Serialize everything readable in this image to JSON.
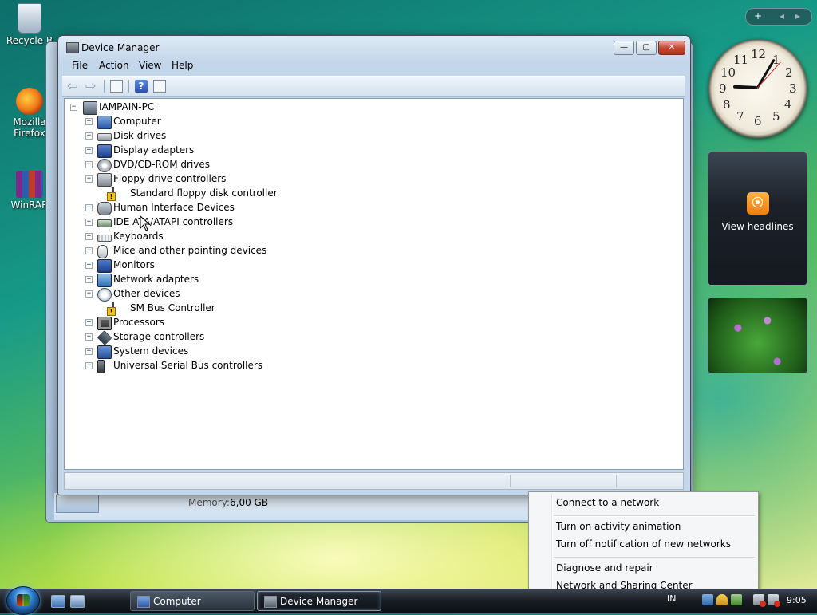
{
  "desktop": {
    "icons": [
      {
        "label": "Recycle B"
      },
      {
        "label": "Mozilla Firefox"
      },
      {
        "label": "WinRAR"
      }
    ]
  },
  "sidebar": {
    "add_glyph": "+",
    "prev_glyph": "◂",
    "next_glyph": "▸",
    "clock": {
      "hour": 9,
      "minute": 5,
      "second": 7
    },
    "clock_numbers": [
      "12",
      "1",
      "2",
      "3",
      "4",
      "5",
      "6",
      "7",
      "8",
      "9",
      "10",
      "11"
    ],
    "feed_label": "View headlines",
    "rss_glyph": "⦿"
  },
  "background_window": {
    "memory_label": "Memory:",
    "memory_value": "6,00 GB"
  },
  "device_manager": {
    "title": "Device Manager",
    "buttons": {
      "minimize": "—",
      "maximize": "▢",
      "close": "✕"
    },
    "menu": [
      "File",
      "Action",
      "View",
      "Help"
    ],
    "toolbar": {
      "back_glyph": "⇦",
      "forward_glyph": "⇨",
      "help_glyph": "?"
    },
    "tree": {
      "root": "IAMPAIN-PC",
      "nodes": [
        {
          "label": "Computer",
          "expander": "+"
        },
        {
          "label": "Disk drives",
          "expander": "+"
        },
        {
          "label": "Display adapters",
          "expander": "+"
        },
        {
          "label": "DVD/CD-ROM drives",
          "expander": "+"
        },
        {
          "label": "Floppy drive controllers",
          "expander": "−"
        },
        {
          "label": "Standard floppy disk controller",
          "child": true
        },
        {
          "label": "Human Interface Devices",
          "expander": "+"
        },
        {
          "label": "IDE ATA/ATAPI controllers",
          "expander": "+"
        },
        {
          "label": "Keyboards",
          "expander": "+"
        },
        {
          "label": "Mice and other pointing devices",
          "expander": "+"
        },
        {
          "label": "Monitors",
          "expander": "+"
        },
        {
          "label": "Network adapters",
          "expander": "+"
        },
        {
          "label": "Other devices",
          "expander": "−"
        },
        {
          "label": "SM Bus Controller",
          "child": true
        },
        {
          "label": "Processors",
          "expander": "+"
        },
        {
          "label": "Storage controllers",
          "expander": "+"
        },
        {
          "label": "System devices",
          "expander": "+"
        },
        {
          "label": "Universal Serial Bus controllers",
          "expander": "+"
        }
      ]
    }
  },
  "context_menu": {
    "items": [
      "Connect to a network",
      "Turn on activity animation",
      "Turn off notification of new networks",
      "Diagnose and repair",
      "Network and Sharing Center"
    ]
  },
  "taskbar": {
    "tasks": [
      "Computer",
      "Device Manager"
    ],
    "language": "IN",
    "time": "9:05"
  }
}
